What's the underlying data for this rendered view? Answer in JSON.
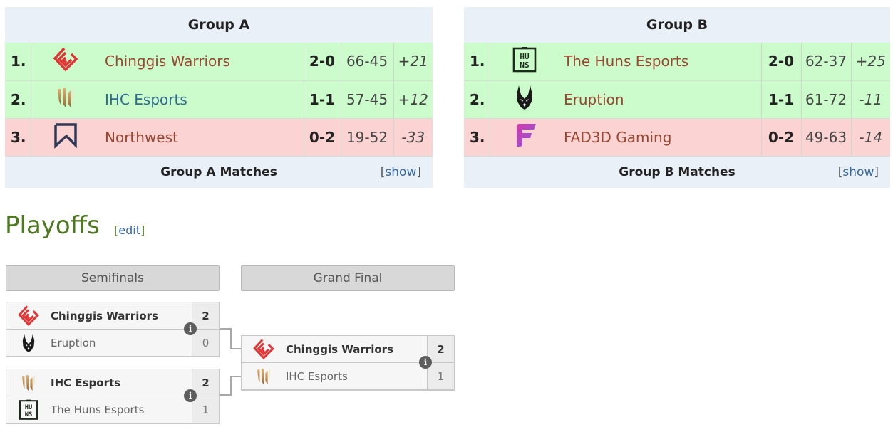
{
  "groups": [
    {
      "title": "Group A",
      "rows": [
        {
          "rank": "1.",
          "team": "Chinggis Warriors",
          "logo": "chinggis-warriors-logo",
          "series": "2-0",
          "games": "66-45",
          "diff": "+21",
          "status": "up"
        },
        {
          "rank": "2.",
          "team": "IHC Esports",
          "logo": "ihc-esports-logo",
          "series": "1-1",
          "games": "57-45",
          "diff": "+12",
          "status": "up"
        },
        {
          "rank": "3.",
          "team": "Northwest",
          "logo": "northwest-logo",
          "series": "0-2",
          "games": "19-52",
          "diff": "-33",
          "status": "down"
        }
      ],
      "footer": "Group A Matches",
      "show_label": "show"
    },
    {
      "title": "Group B",
      "rows": [
        {
          "rank": "1.",
          "team": "The Huns Esports",
          "logo": "the-huns-esports-logo",
          "series": "2-0",
          "games": "62-37",
          "diff": "+25",
          "status": "up"
        },
        {
          "rank": "2.",
          "team": "Eruption",
          "logo": "eruption-logo",
          "series": "1-1",
          "games": "61-72",
          "diff": "-11",
          "status": "up"
        },
        {
          "rank": "3.",
          "team": "FAD3D Gaming",
          "logo": "fad3d-gaming-logo",
          "series": "0-2",
          "games": "49-63",
          "diff": "-14",
          "status": "down"
        }
      ],
      "footer": "Group B Matches",
      "show_label": "show"
    }
  ],
  "playoffs": {
    "heading": "Playoffs",
    "edit_label": "edit",
    "rounds": [
      "Semifinals",
      "Grand Final"
    ],
    "matches": [
      {
        "id": "sf1",
        "opponents": [
          {
            "team": "Chinggis Warriors",
            "score": "2",
            "winner": true
          },
          {
            "team": "Eruption",
            "score": "0",
            "winner": false
          }
        ]
      },
      {
        "id": "sf2",
        "opponents": [
          {
            "team": "IHC Esports",
            "score": "2",
            "winner": true
          },
          {
            "team": "The Huns Esports",
            "score": "1",
            "winner": false
          }
        ]
      },
      {
        "id": "gf",
        "opponents": [
          {
            "team": "Chinggis Warriors",
            "score": "2",
            "winner": true
          },
          {
            "team": "IHC Esports",
            "score": "1",
            "winner": false
          }
        ]
      }
    ]
  },
  "colors": {
    "advance_row": "#ccfccc",
    "eliminated_row": "#fbd3d3",
    "heading_green": "#4d7a1d",
    "link_blue": "#3366cc"
  }
}
